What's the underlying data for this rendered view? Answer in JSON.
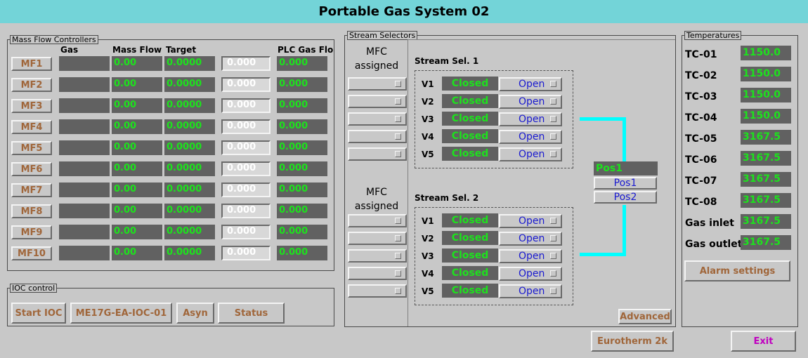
{
  "title": "Portable Gas System 02",
  "mfc": {
    "group_label": "Mass Flow Controllers",
    "headers": {
      "gas": "Gas",
      "mass_flow": "Mass Flow",
      "target": "Target",
      "plc_gas_flow": "PLC Gas Flo"
    },
    "rows": [
      {
        "label": "MF1",
        "gas": "",
        "mass_flow": "0.00",
        "target": "0.0000",
        "setpoint": "0.000",
        "plc": "0.000"
      },
      {
        "label": "MF2",
        "gas": "",
        "mass_flow": "0.00",
        "target": "0.0000",
        "setpoint": "0.000",
        "plc": "0.000"
      },
      {
        "label": "MF3",
        "gas": "",
        "mass_flow": "0.00",
        "target": "0.0000",
        "setpoint": "0.000",
        "plc": "0.000"
      },
      {
        "label": "MF4",
        "gas": "",
        "mass_flow": "0.00",
        "target": "0.0000",
        "setpoint": "0.000",
        "plc": "0.000"
      },
      {
        "label": "MF5",
        "gas": "",
        "mass_flow": "0.00",
        "target": "0.0000",
        "setpoint": "0.000",
        "plc": "0.000"
      },
      {
        "label": "MF6",
        "gas": "",
        "mass_flow": "0.00",
        "target": "0.0000",
        "setpoint": "0.000",
        "plc": "0.000"
      },
      {
        "label": "MF7",
        "gas": "",
        "mass_flow": "0.00",
        "target": "0.0000",
        "setpoint": "0.000",
        "plc": "0.000"
      },
      {
        "label": "MF8",
        "gas": "",
        "mass_flow": "0.00",
        "target": "0.0000",
        "setpoint": "0.000",
        "plc": "0.000"
      },
      {
        "label": "MF9",
        "gas": "",
        "mass_flow": "0.00",
        "target": "0.0000",
        "setpoint": "0.000",
        "plc": "0.000"
      },
      {
        "label": "MF10",
        "gas": "",
        "mass_flow": "0.00",
        "target": "0.0000",
        "setpoint": "0.000",
        "plc": "0.000"
      }
    ]
  },
  "ioc": {
    "group_label": "IOC control",
    "buttons": [
      "Start IOC",
      "ME17G-EA-IOC-01",
      "Asyn",
      "Status"
    ]
  },
  "stream": {
    "group_label": "Stream Selectors",
    "mfc_assigned_line1": "MFC",
    "mfc_assigned_line2": "assigned",
    "sel1": {
      "title": "Stream Sel. 1",
      "valves": [
        {
          "label": "V1",
          "state": "Closed",
          "action": "Open"
        },
        {
          "label": "V2",
          "state": "Closed",
          "action": "Open"
        },
        {
          "label": "V3",
          "state": "Closed",
          "action": "Open"
        },
        {
          "label": "V4",
          "state": "Closed",
          "action": "Open"
        },
        {
          "label": "V5",
          "state": "Closed",
          "action": "Open"
        }
      ]
    },
    "sel2": {
      "title": "Stream Sel. 2",
      "valves": [
        {
          "label": "V1",
          "state": "Closed",
          "action": "Open"
        },
        {
          "label": "V2",
          "state": "Closed",
          "action": "Open"
        },
        {
          "label": "V3",
          "state": "Closed",
          "action": "Open"
        },
        {
          "label": "V4",
          "state": "Closed",
          "action": "Open"
        },
        {
          "label": "V5",
          "state": "Closed",
          "action": "Open"
        }
      ]
    },
    "position_value": "Pos1",
    "pos1_button": "Pos1",
    "pos2_button": "Pos2",
    "advanced_button": "Advanced"
  },
  "temps": {
    "group_label": "Temperatures",
    "items": [
      {
        "label": "TC-01",
        "value": "1150.0"
      },
      {
        "label": "TC-02",
        "value": "1150.0"
      },
      {
        "label": "TC-03",
        "value": "1150.0"
      },
      {
        "label": "TC-04",
        "value": "1150.0"
      },
      {
        "label": "TC-05",
        "value": "3167.5"
      },
      {
        "label": "TC-06",
        "value": "3167.5"
      },
      {
        "label": "TC-07",
        "value": "3167.5"
      },
      {
        "label": "TC-08",
        "value": "3167.5"
      },
      {
        "label": "Gas inlet",
        "value": "3167.5"
      },
      {
        "label": "Gas outlet",
        "value": "3167.5"
      }
    ],
    "alarm_button": "Alarm settings"
  },
  "eurotherm_button": "Eurotherm 2k",
  "exit_button": "Exit",
  "colors": {
    "title_bar": "#73d4d8",
    "readout_bg": "#616161",
    "readout_text": "#1de21d",
    "button_text": "#a0663a",
    "link_text": "#1a1ad0",
    "pipe": "#00ffff",
    "exit_text": "#c000c0"
  }
}
